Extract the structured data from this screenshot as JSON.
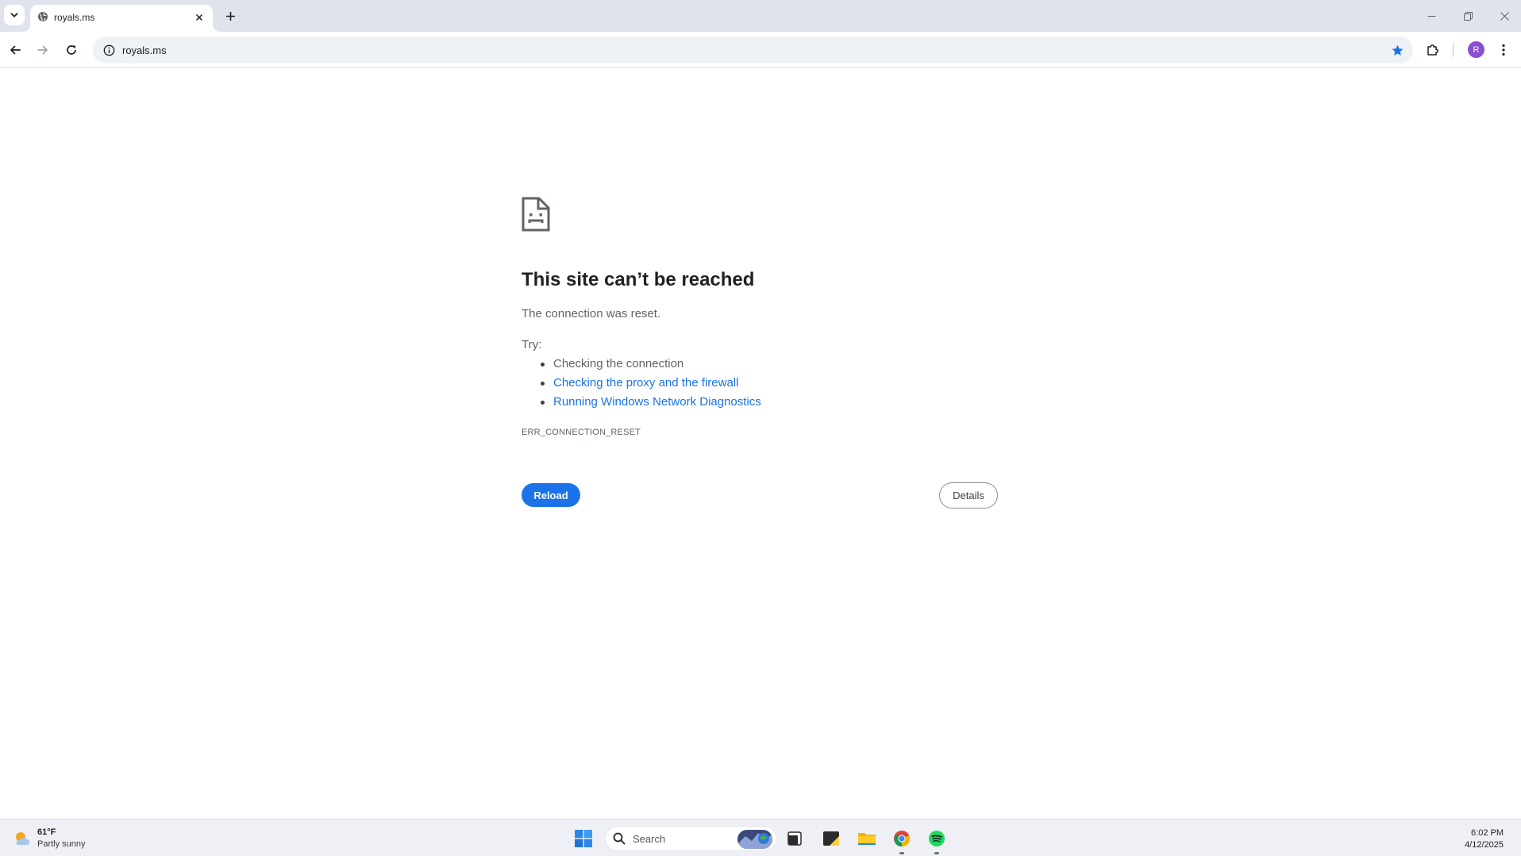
{
  "browser": {
    "tab": {
      "title": "royals.ms"
    },
    "address_bar": {
      "url": "royals.ms"
    },
    "profile_initial": "R"
  },
  "error_page": {
    "title": "This site can’t be reached",
    "description": "The connection was reset.",
    "try_label": "Try:",
    "suggestions": [
      {
        "text": "Checking the connection",
        "is_link": false
      },
      {
        "text": "Checking the proxy and the firewall",
        "is_link": true
      },
      {
        "text": "Running Windows Network Diagnostics",
        "is_link": true
      }
    ],
    "error_code": "ERR_CONNECTION_RESET",
    "reload_label": "Reload",
    "details_label": "Details"
  },
  "taskbar": {
    "weather": {
      "temp": "61°F",
      "condition": "Partly sunny"
    },
    "search_placeholder": "Search",
    "clock": {
      "time": "6:02 PM",
      "date": "4/12/2025"
    },
    "apps": [
      "start-icon",
      "task-view-icon",
      "sticky-notes-icon",
      "file-explorer-icon",
      "chrome-icon",
      "spotify-icon"
    ]
  },
  "colors": {
    "accent": "#1a73e8",
    "tabstrip": "#dfe3eb",
    "omnibox": "#eef1f6",
    "avatar": "#8a4fd0",
    "spotify": "#1ed760"
  }
}
